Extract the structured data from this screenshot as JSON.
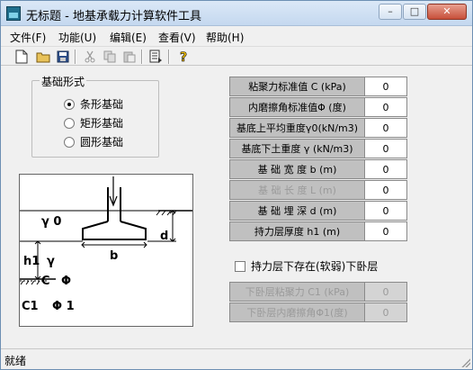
{
  "window": {
    "title": "无标题 - 地基承载力计算软件工具",
    "minimize_glyph": "–",
    "maximize_glyph": "□",
    "close_glyph": "✕"
  },
  "menu": {
    "items": [
      {
        "label": "文件(F)"
      },
      {
        "label": "功能(U)"
      },
      {
        "label": "编辑(E)"
      },
      {
        "label": "查看(V)"
      },
      {
        "label": "帮助(H)"
      }
    ]
  },
  "toolbar": {
    "icons": [
      "new-file-icon",
      "open-folder-icon",
      "save-icon",
      "cut-icon",
      "copy-icon",
      "paste-icon",
      "export-icon",
      "help-icon"
    ]
  },
  "foundation_type": {
    "title": "基础形式",
    "options": [
      {
        "label": "条形基础",
        "checked": true
      },
      {
        "label": "矩形基础",
        "checked": false
      },
      {
        "label": "圆形基础",
        "checked": false
      }
    ]
  },
  "diagram": {
    "gamma0": "γ 0",
    "d": "d",
    "h1": "h1",
    "gamma": "γ",
    "b": "b",
    "c": "C",
    "phi": "Φ",
    "c1": "C1",
    "phi1": "Φ 1"
  },
  "params": [
    {
      "label": "粘聚力标准值 C  (kPa)",
      "value": "0",
      "enabled": true
    },
    {
      "label": "内磨擦角标准值Φ (度)",
      "value": "0",
      "enabled": true
    },
    {
      "label": "基底上平均重度γ0(kN/m3)",
      "value": "0",
      "enabled": true
    },
    {
      "label": "基底下土重度 γ (kN/m3)",
      "value": "0",
      "enabled": true
    },
    {
      "label": "基 础 宽 度 b   (m)",
      "value": "0",
      "enabled": true
    },
    {
      "label": "基 础 长 度 L   (m)",
      "value": "0",
      "enabled": false
    },
    {
      "label": "基 础 埋 深 d   (m)",
      "value": "0",
      "enabled": true
    },
    {
      "label": "持力层厚度 h1   (m)",
      "value": "0",
      "enabled": true
    }
  ],
  "weak_layer": {
    "checkbox_label": "持力层下存在(软弱)下卧层",
    "checked": false,
    "params": [
      {
        "label": "下卧层粘聚力 C1 (kPa)",
        "value": "0",
        "enabled": false
      },
      {
        "label": "下卧层内磨擦角Φ1(度)",
        "value": "0",
        "enabled": false
      }
    ]
  },
  "status": {
    "text": "就绪"
  }
}
